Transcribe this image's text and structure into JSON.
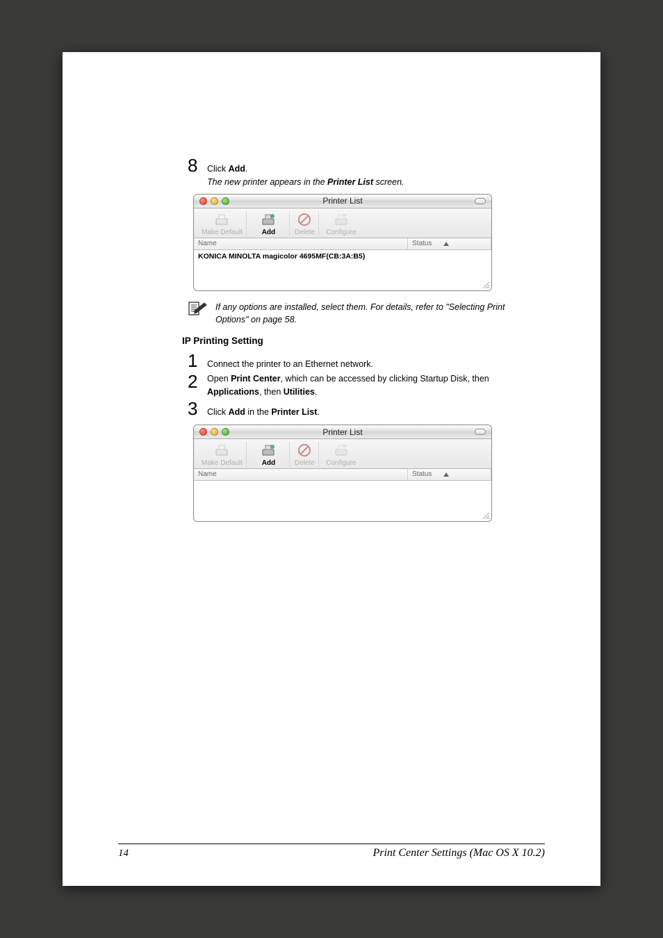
{
  "step8": {
    "num": "8",
    "pre": "Click ",
    "bold": "Add",
    "post": ".",
    "sub_pre": "The new printer appears in the ",
    "sub_bold": "Printer List",
    "sub_post": " screen."
  },
  "window": {
    "title": "Printer List",
    "toolbar": {
      "make_default": "Make Default",
      "add": "Add",
      "delete": "Delete",
      "configure": "Configure"
    },
    "columns": {
      "name": "Name",
      "status": "Status"
    },
    "row1": "KONICA MINOLTA magicolor 4695MF(CB:3A:B5)"
  },
  "note": {
    "text": "If any options are installed, select them. For details, refer to \"Selecting Print Options\" on page 58."
  },
  "ip_section": {
    "heading": "IP Printing Setting"
  },
  "step1": {
    "num": "1",
    "text": "Connect the printer to an Ethernet network."
  },
  "step2": {
    "num": "2",
    "t1": "Open ",
    "b1": "Print Center",
    "t2": ", which can be accessed by clicking Startup Disk, then ",
    "b2": "Applications",
    "t3": ", then ",
    "b3": "Utilities",
    "t4": "."
  },
  "step3": {
    "num": "3",
    "t1": "Click ",
    "b1": "Add",
    "t2": " in the ",
    "b2": "Printer List",
    "t3": "."
  },
  "footer": {
    "page": "14",
    "title": "Print Center Settings (Mac OS X 10.2)"
  }
}
